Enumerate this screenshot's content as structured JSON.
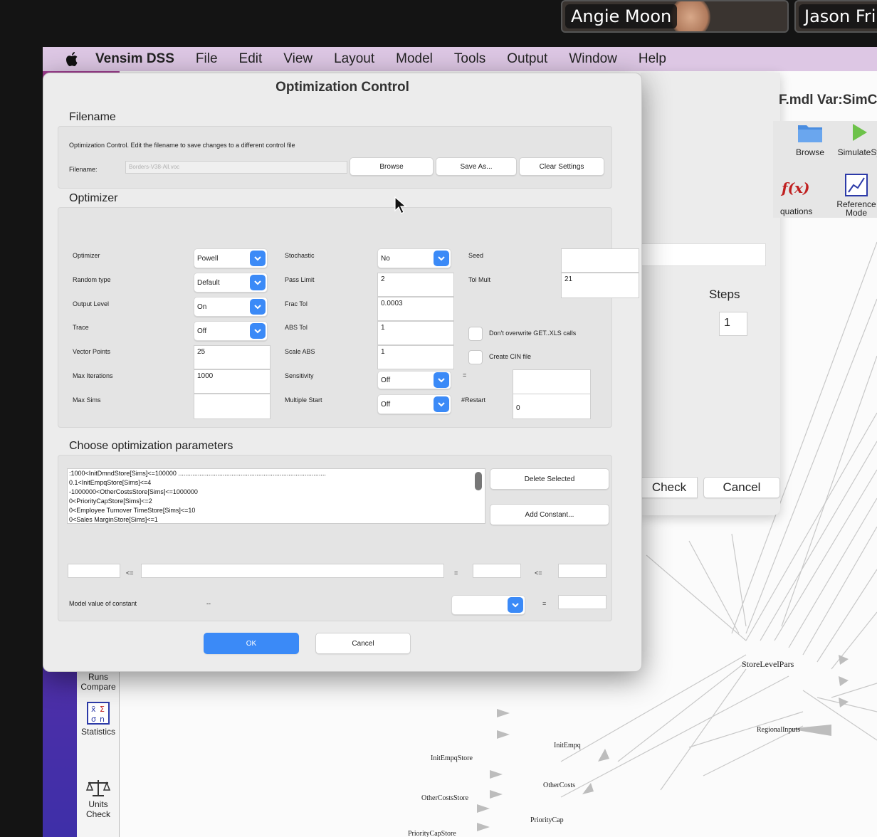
{
  "call": {
    "participant_1": "Angie Moon",
    "participant_2": "Jason Fri"
  },
  "menubar": {
    "app_name": "Vensim DSS",
    "items": [
      "File",
      "Edit",
      "View",
      "Layout",
      "Model",
      "Tools",
      "Output",
      "Window",
      "Help"
    ]
  },
  "back_window": {
    "title": "F.mdl Var:SimC",
    "browse_label": "Browse",
    "simulate_label": "SimulateSy",
    "equations_label": "quations",
    "reference_mode_label": "Reference\nMode",
    "steps_label": "Steps",
    "steps_value": "1",
    "check_label": "Check",
    "cancel_label": "Cancel"
  },
  "left_toolbar": {
    "runs_compare": "Runs\nCompare",
    "statistics": "Statistics",
    "units_check": "Units\nCheck"
  },
  "canvas_labels": {
    "store_level_pars": "StoreLevelPars",
    "regional_inputs": "RegionalInputs",
    "init_empq": "InitEmpq",
    "init_empq_store": "InitEmpqStore",
    "other_costs": "OtherCosts",
    "other_costs_store": "OtherCostsStore",
    "priority_cap": "PriorityCap",
    "priority_cap_store": "PriorityCapStore"
  },
  "dialog": {
    "title": "Optimization Control",
    "filename_section": "Filename",
    "filename_hint": "Optimization Control.  Edit the filename to save changes to a different control file",
    "filename_label": "Filename:",
    "filename_value": "Borders-V38-All.voc",
    "browse_button": "Browse",
    "save_as_button": "Save As...",
    "clear_settings_button": "Clear Settings",
    "optimizer_section": "Optimizer",
    "optimizer_label": "Optimizer",
    "optimizer_value": "Powell",
    "random_type_label": "Random type",
    "random_type_value": "Default",
    "output_level_label": "Output Level",
    "output_level_value": "On",
    "trace_label": "Trace",
    "trace_value": "Off",
    "vector_points_label": "Vector Points",
    "vector_points_value": "25",
    "max_iterations_label": "Max Iterations",
    "max_iterations_value": "1000",
    "max_sims_label": "Max Sims",
    "max_sims_value": "",
    "stochastic_label": "Stochastic",
    "stochastic_value": "No",
    "pass_limit_label": "Pass Limit",
    "pass_limit_value": "2",
    "frac_tol_label": "Frac Tol",
    "frac_tol_value": "0.0003",
    "abs_tol_label": "ABS Tol",
    "abs_tol_value": "1",
    "scale_abs_label": "Scale ABS",
    "scale_abs_value": "1",
    "sensitivity_label": "Sensitivity",
    "sensitivity_value": "Off",
    "sensitivity_eq": "=",
    "multiple_start_label": "Multiple Start",
    "multiple_start_value": "Off",
    "seed_label": "Seed",
    "seed_value": "",
    "tol_mult_label": "Tol Mult",
    "tol_mult_value": "21",
    "dont_overwrite_label": "Don't overwrite GET..XLS calls",
    "create_cin_label": "Create CIN file",
    "restart_label": "#Restart",
    "restart_value": "0",
    "params_section": "Choose optimization parameters",
    "params": [
      ":1000<InitDmndStore[Sims]<=100000 ...................................................................................",
      "0.1<InitEmpqStore[Sims]<=4",
      "-1000000<OtherCostsStore[Sims]<=1000000",
      "0<PriorityCapStore[Sims]<=2",
      "0<Employee Turnover TimeStore[Sims]<=10",
      "0<Sales MarginStore[Sims]<=1"
    ],
    "delete_selected_button": "Delete Selected",
    "add_constant_button": "Add Constant...",
    "le_symbol_1": "<=",
    "eq_symbol": "=",
    "le_symbol_2": "<=",
    "model_value_label": "Model value of constant",
    "model_value": "--",
    "eq_symbol_2": "=",
    "ok_button": "OK",
    "cancel_button": "Cancel"
  }
}
